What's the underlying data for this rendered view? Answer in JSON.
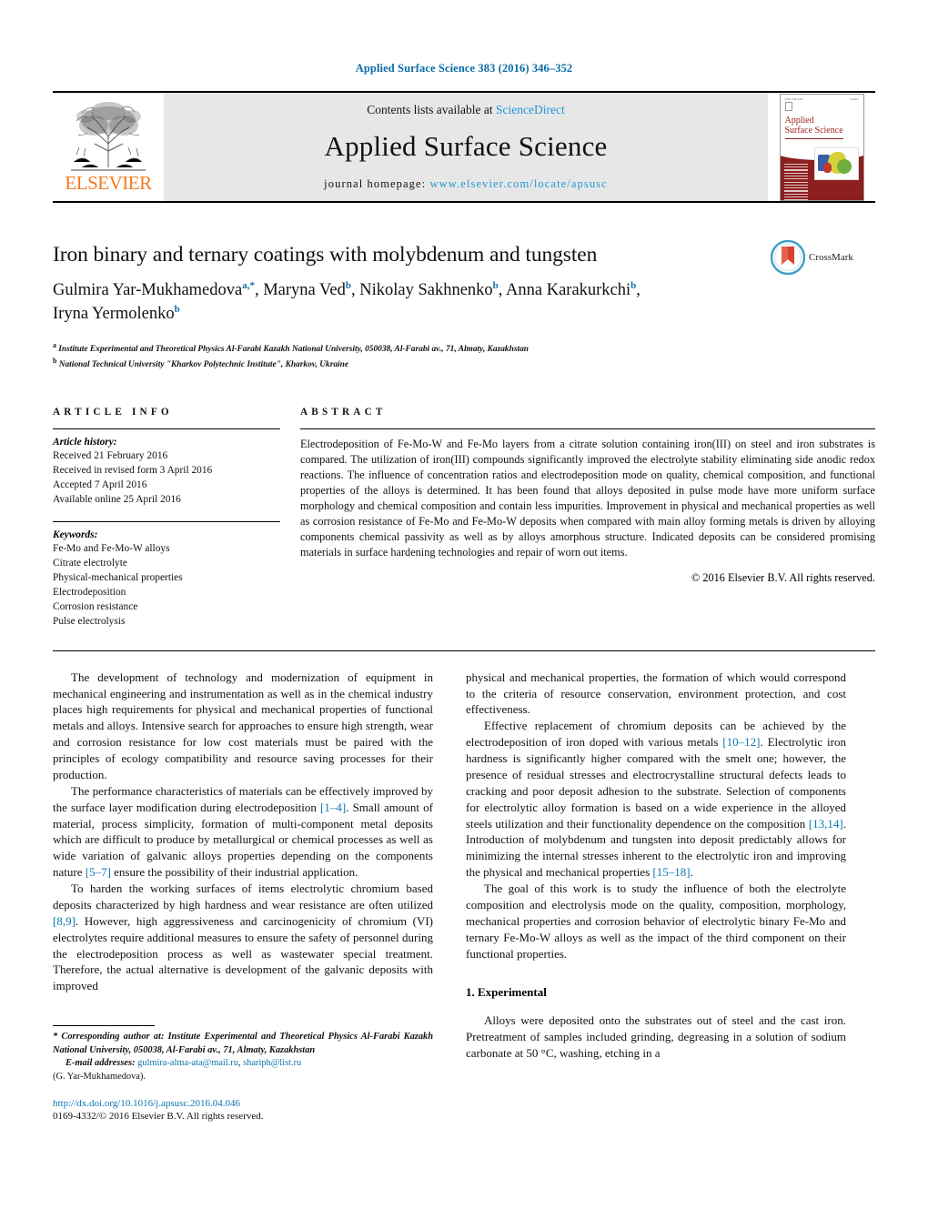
{
  "running_head": "Applied Surface Science 383 (2016) 346–352",
  "masthead": {
    "publisher": "ELSEVIER",
    "contents_prefix": "Contents lists available at ",
    "contents_link": "ScienceDirect",
    "journal_title": "Applied Surface Science",
    "homepage_prefix": "journal homepage: ",
    "homepage_url": "www.elsevier.com/locate/apsusc",
    "cover_title_line1": "Applied",
    "cover_title_line2": "Surface Science"
  },
  "article": {
    "title": "Iron binary and ternary coatings with molybdenum and tungsten",
    "authors_line1_a": "Gulmira Yar-Mukhamedova",
    "authors_line1_a_sup": "a,*",
    "authors_line1_b": ", Maryna Ved",
    "authors_line1_b_sup": "b",
    "authors_line1_c": ", Nikolay Sakhnenko",
    "authors_line1_c_sup": "b",
    "authors_line1_d": ", Anna Karakurkchi",
    "authors_line1_d_sup": "b",
    "authors_line1_end": ",",
    "authors_line2": "Iryna Yermolenko",
    "authors_line2_sup": "b",
    "crossmark_label": "CrossMark",
    "affiliation_a_sup": "a",
    "affiliation_a": "Institute Experimental and Theoretical Physics Al-Farabi Kazakh National University, 050038, Al-Farabi av., 71, Almaty, Kazakhstan",
    "affiliation_b_sup": "b",
    "affiliation_b": "National Technical University \"Kharkov Polytechnic Institute\", Kharkov, Ukraine"
  },
  "article_info": {
    "heading": "ARTICLE INFO",
    "history_title": "Article history:",
    "history": [
      "Received 21 February 2016",
      "Received in revised form 3 April 2016",
      "Accepted 7 April 2016",
      "Available online 25 April 2016"
    ],
    "keywords_title": "Keywords:",
    "keywords": [
      "Fe-Mo and Fe-Mo-W alloys",
      "Citrate electrolyte",
      "Physical-mechanical properties",
      "Electrodeposition",
      "Corrosion resistance",
      "Pulse electrolysis"
    ]
  },
  "abstract": {
    "heading": "ABSTRACT",
    "text": "Electrodeposition of Fe-Mo-W and Fe-Mo layers from a citrate solution containing iron(III) on steel and iron substrates is compared. The utilization of iron(III) compounds significantly improved the electrolyte stability eliminating side anodic redox reactions. The influence of concentration ratios and electrodeposition mode on quality, chemical composition, and functional properties of the alloys is determined. It has been found that alloys deposited in pulse mode have more uniform surface morphology and chemical composition and contain less impurities. Improvement in physical and mechanical properties as well as corrosion resistance of Fe-Mo and Fe-Mo-W deposits when compared with main alloy forming metals is driven by alloying components chemical passivity as well as by alloys amorphous structure. Indicated deposits can be considered promising materials in surface hardening technologies and repair of worn out items.",
    "copyright": "© 2016 Elsevier B.V. All rights reserved."
  },
  "body": {
    "left": {
      "p1": "The development of technology and modernization of equipment in mechanical engineering and instrumentation as well as in the chemical industry places high requirements for physical and mechanical properties of functional metals and alloys. Intensive search for approaches to ensure high strength, wear and corrosion resistance for low cost materials must be paired with the principles of ecology compatibility and resource saving processes for their production.",
      "p2_part1": "The performance characteristics of materials can be effectively improved by the surface layer modification during electrodeposition ",
      "p2_ref1": "[1–4]",
      "p2_part2": ". Small amount of material, process simplicity, formation of multi-component metal deposits which are difficult to produce by metallurgical or chemical processes as well as wide variation of galvanic alloys properties depending on the components nature ",
      "p2_ref2": "[5–7]",
      "p2_part3": " ensure the possibility of their industrial application.",
      "p3_part1": "To harden the working surfaces of items electrolytic chromium based deposits characterized by high hardness and wear resistance are often utilized ",
      "p3_ref1": "[8,9]",
      "p3_part2": ". However, high aggressiveness and carcinogenicity of chromium (VI) electrolytes require additional measures to ensure the safety of personnel during the electrodeposition process as well as wastewater special treatment. Therefore, the actual alternative is development of the galvanic deposits with improved"
    },
    "right": {
      "p1": "physical and mechanical properties, the formation of which would correspond to the criteria of resource conservation, environment protection, and cost effectiveness.",
      "p2_part1": "Effective replacement of chromium deposits can be achieved by the electrodeposition of iron doped with various metals ",
      "p2_ref1": "[10–12]",
      "p2_part2": ". Electrolytic iron hardness is significantly higher compared with the smelt one; however, the presence of residual stresses and electrocrystalline structural defects leads to cracking and poor deposit adhesion to the substrate. Selection of components for electrolytic alloy formation is based on a wide experience in the alloyed steels utilization and their functionality dependence on the composition ",
      "p2_ref2": "[13,14]",
      "p2_part3": ". Introduction of molybdenum and tungsten into deposit predictably allows for minimizing the internal stresses inherent to the electrolytic iron and improving the physical and mechanical properties ",
      "p2_ref3": "[15–18]",
      "p2_part4": ".",
      "p3": "The goal of this work is to study the influence of both the electrolyte composition and electrolysis mode on the quality, composition, morphology, mechanical properties and corrosion behavior of electrolytic binary Fe-Mo and ternary Fe-Mo-W alloys as well as the impact of the third component on their functional properties.",
      "section_heading": "1. Experimental",
      "p4": "Alloys were deposited onto the substrates out of steel and the cast iron. Pretreatment of samples included grinding, degreasing in a solution of sodium carbonate at 50 °C, washing, etching in a"
    }
  },
  "footer": {
    "corresponding_marker": "*",
    "corresponding_text": " Corresponding author at: Institute Experimental and Theoretical Physics Al-Farabi Kazakh National University, 050038, Al-Farabi av., 71, Almaty, Kazakhstan",
    "email_label": "E-mail addresses:",
    "email1": "gulmira-alma-ata@mail.ru",
    "email_sep": ", ",
    "email2": "shariph@list.ru",
    "email_author": "(G. Yar-Mukhamedova).",
    "doi": "http://dx.doi.org/10.1016/j.apsusc.2016.04.046",
    "issn": "0169-4332/© 2016 Elsevier B.V. All rights reserved."
  },
  "colors": {
    "link_blue": "#0b76b0",
    "science_direct_blue": "#2196d6",
    "elsevier_orange": "#F47B20",
    "cover_red": "#8d1f1f"
  }
}
